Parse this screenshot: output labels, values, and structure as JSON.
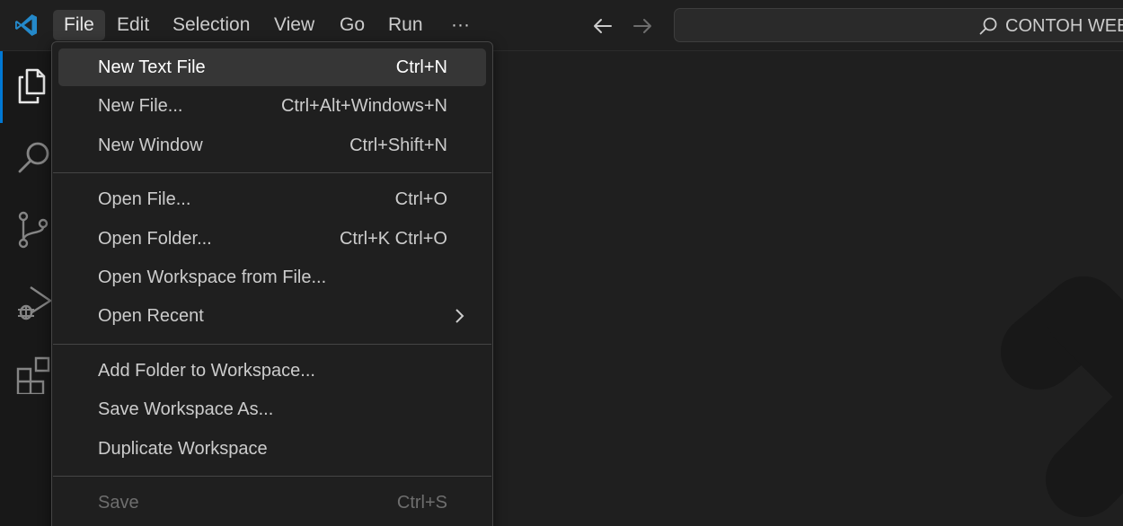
{
  "colors": {
    "accent": "#0078d4",
    "background": "#1f1f1f",
    "menu_highlight": "#363636",
    "disabled_text": "#6e6e6e"
  },
  "titlebar": {
    "logo_icon": "vscode-logo-icon",
    "menus": [
      "File",
      "Edit",
      "Selection",
      "View",
      "Go",
      "Run",
      "···"
    ],
    "active_menu": "File",
    "back_icon": "arrow-left-icon",
    "forward_icon": "arrow-right-icon",
    "command_center": {
      "icon": "search-icon",
      "text": "CONTOH WEBSITE"
    }
  },
  "activitybar": {
    "items": [
      {
        "icon": "explorer-files-icon",
        "active": true
      },
      {
        "icon": "search-icon",
        "active": false
      },
      {
        "icon": "source-control-icon",
        "active": false
      },
      {
        "icon": "run-debug-icon",
        "active": false
      },
      {
        "icon": "extensions-icon",
        "active": false
      }
    ]
  },
  "file_menu": {
    "groups": [
      [
        {
          "label": "New Text File",
          "shortcut": "Ctrl+N",
          "selected": true
        },
        {
          "label": "New File...",
          "shortcut": "Ctrl+Alt+Windows+N"
        },
        {
          "label": "New Window",
          "shortcut": "Ctrl+Shift+N"
        }
      ],
      [
        {
          "label": "Open File...",
          "shortcut": "Ctrl+O"
        },
        {
          "label": "Open Folder...",
          "shortcut": "Ctrl+K Ctrl+O"
        },
        {
          "label": "Open Workspace from File...",
          "shortcut": ""
        },
        {
          "label": "Open Recent",
          "shortcut": "",
          "submenu": true
        }
      ],
      [
        {
          "label": "Add Folder to Workspace...",
          "shortcut": ""
        },
        {
          "label": "Save Workspace As...",
          "shortcut": ""
        },
        {
          "label": "Duplicate Workspace",
          "shortcut": ""
        }
      ],
      [
        {
          "label": "Save",
          "shortcut": "Ctrl+S",
          "disabled": true
        }
      ]
    ]
  },
  "editor": {
    "watermark_icon": "vscode-watermark-icon"
  }
}
